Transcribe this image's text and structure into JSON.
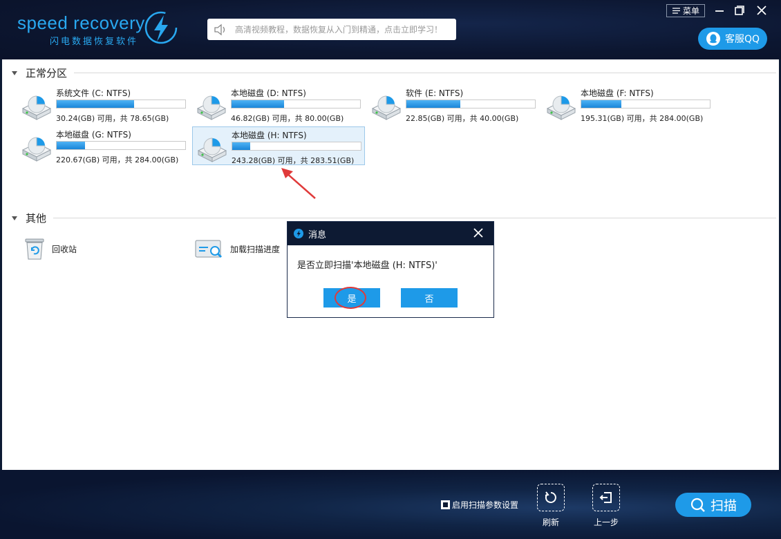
{
  "header": {
    "logo_text": "speed recovery",
    "logo_subtitle": "闪电数据恢复软件",
    "notice_text": "高清视频教程，数据恢复从入门到精通，点击立即学习！",
    "menu_label": "菜单",
    "qq_label": "客服QQ"
  },
  "sections": {
    "normal_title": "正常分区",
    "other_title": "其他"
  },
  "drives": [
    {
      "name": "系统文件 (C: NTFS)",
      "info": "30.24(GB) 可用，共 78.65(GB)",
      "used_fraction": 0.6
    },
    {
      "name": "本地磁盘 (D: NTFS)",
      "info": "46.82(GB) 可用，共 80.00(GB)",
      "used_fraction": 0.41
    },
    {
      "name": "软件 (E: NTFS)",
      "info": "22.85(GB) 可用，共 40.00(GB)",
      "used_fraction": 0.42
    },
    {
      "name": "本地磁盘 (F: NTFS)",
      "info": "195.31(GB) 可用，共 284.00(GB)",
      "used_fraction": 0.31
    },
    {
      "name": "本地磁盘 (G: NTFS)",
      "info": "220.67(GB) 可用，共 284.00(GB)",
      "used_fraction": 0.22
    },
    {
      "name": "本地磁盘 (H: NTFS)",
      "info": "243.28(GB) 可用，共 283.51(GB)",
      "used_fraction": 0.14
    }
  ],
  "others": {
    "recycle_label": "回收站",
    "load_progress_label": "加载扫描进度"
  },
  "dialog": {
    "title": "消息",
    "message": "是否立即扫描'本地磁盘 (H: NTFS)'",
    "yes_label": "是",
    "no_label": "否"
  },
  "footer": {
    "scan_params_label": "启用扫描参数设置",
    "refresh_label": "刷新",
    "back_label": "上一步",
    "scan_label": "扫描"
  },
  "colors": {
    "accent": "#1e9ae8",
    "dark_bg": "#0d1a33",
    "annotation_red": "#e03a3a"
  }
}
